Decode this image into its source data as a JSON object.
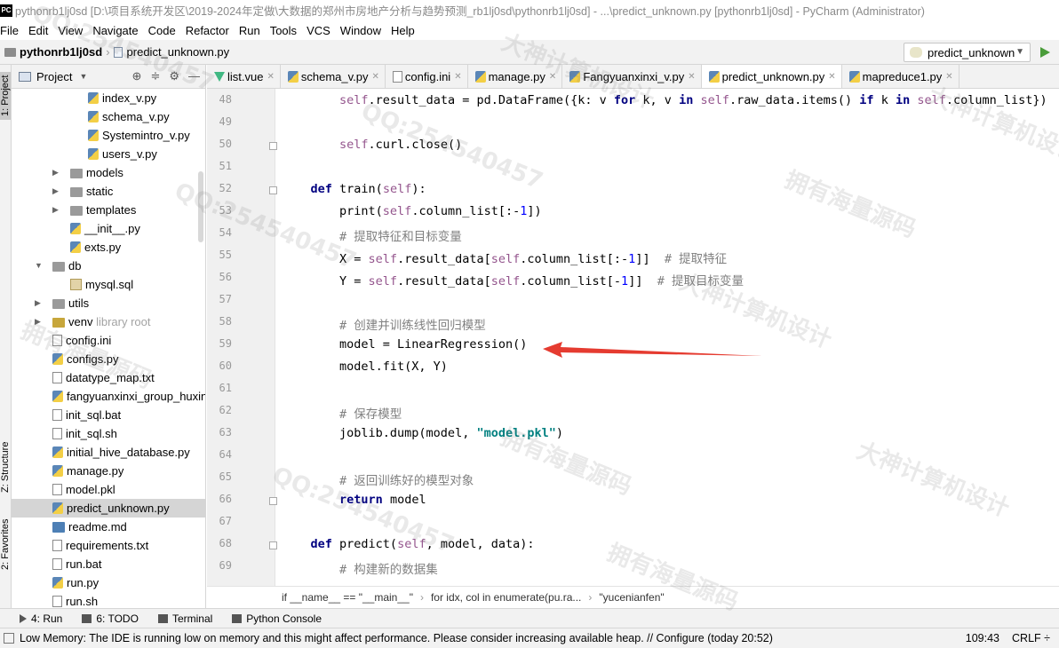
{
  "title_bar": {
    "text": "pythonrb1lj0sd [D:\\项目系统开发区\\2019-2024年定做\\大数据的郑州市房地产分析与趋势预测_rb1lj0sd\\pythonrb1lj0sd] - ...\\predict_unknown.py [pythonrb1lj0sd] - PyCharm (Administrator)"
  },
  "menu": [
    "File",
    "Edit",
    "View",
    "Navigate",
    "Code",
    "Refactor",
    "Run",
    "Tools",
    "VCS",
    "Window",
    "Help"
  ],
  "nav": {
    "project": "pythonrb1lj0sd",
    "file": "predict_unknown.py",
    "run_config": "predict_unknown"
  },
  "left_strip": {
    "project_tab": "1: Project",
    "structure_tab": "Z: Structure",
    "favorites_tab": "2: Favorites"
  },
  "project_panel": {
    "title": "Project",
    "tree": [
      {
        "label": "index_v.py",
        "icon": "python-file-icon",
        "depth": 3
      },
      {
        "label": "schema_v.py",
        "icon": "python-file-icon",
        "depth": 3
      },
      {
        "label": "Systemintro_v.py",
        "icon": "python-file-icon",
        "depth": 3
      },
      {
        "label": "users_v.py",
        "icon": "python-file-icon",
        "depth": 3
      },
      {
        "label": "models",
        "icon": "folder-icon",
        "depth": 2,
        "arrow": "right"
      },
      {
        "label": "static",
        "icon": "folder-icon",
        "depth": 2,
        "arrow": "right"
      },
      {
        "label": "templates",
        "icon": "folder-icon",
        "depth": 2,
        "arrow": "right"
      },
      {
        "label": "__init__.py",
        "icon": "python-file-icon",
        "depth": 2
      },
      {
        "label": "exts.py",
        "icon": "python-file-icon",
        "depth": 2
      },
      {
        "label": "db",
        "icon": "folder-icon",
        "depth": 1,
        "arrow": "down"
      },
      {
        "label": "mysql.sql",
        "icon": "sql-file-icon",
        "depth": 2
      },
      {
        "label": "utils",
        "icon": "folder-icon",
        "depth": 1,
        "arrow": "right"
      },
      {
        "label": "venv",
        "suffix": "library root",
        "icon": "venv-folder-icon",
        "depth": 1,
        "arrow": "right"
      },
      {
        "label": "config.ini",
        "icon": "text-file-icon",
        "depth": 1
      },
      {
        "label": "configs.py",
        "icon": "python-file-icon",
        "depth": 1
      },
      {
        "label": "datatype_map.txt",
        "icon": "text-file-icon",
        "depth": 1
      },
      {
        "label": "fangyuanxinxi_group_huxing",
        "icon": "python-file-icon",
        "depth": 1
      },
      {
        "label": "init_sql.bat",
        "icon": "text-file-icon",
        "depth": 1
      },
      {
        "label": "init_sql.sh",
        "icon": "text-file-icon",
        "depth": 1
      },
      {
        "label": "initial_hive_database.py",
        "icon": "python-file-icon",
        "depth": 1
      },
      {
        "label": "manage.py",
        "icon": "python-file-icon",
        "depth": 1
      },
      {
        "label": "model.pkl",
        "icon": "text-file-icon",
        "depth": 1
      },
      {
        "label": "predict_unknown.py",
        "icon": "python-file-icon",
        "depth": 1,
        "selected": true
      },
      {
        "label": "readme.md",
        "icon": "markdown-file-icon",
        "depth": 1
      },
      {
        "label": "requirements.txt",
        "icon": "text-file-icon",
        "depth": 1
      },
      {
        "label": "run.bat",
        "icon": "text-file-icon",
        "depth": 1
      },
      {
        "label": "run.py",
        "icon": "python-file-icon",
        "depth": 1
      },
      {
        "label": "run.sh",
        "icon": "text-file-icon",
        "depth": 1
      }
    ]
  },
  "tabs": [
    {
      "label": "list.vue",
      "icon": "vue-file-icon"
    },
    {
      "label": "schema_v.py",
      "icon": "python-file-icon"
    },
    {
      "label": "config.ini",
      "icon": "text-file-icon"
    },
    {
      "label": "manage.py",
      "icon": "python-file-icon"
    },
    {
      "label": "Fangyuanxinxi_v.py",
      "icon": "python-file-icon"
    },
    {
      "label": "predict_unknown.py",
      "icon": "python-file-icon",
      "active": true
    },
    {
      "label": "mapreduce1.py",
      "icon": "python-file-icon"
    }
  ],
  "code_lines": [
    {
      "n": "48",
      "html": "        <span class='self'>self</span>.result_data = pd.DataFrame({k: v <span class='kw'>for</span> k, v <span class='kw'>in</span> <span class='self'>self</span>.raw_data.items() <span class='kw'>if</span> k <span class='kw'>in</span> <span class='self'>self</span>.column_list})"
    },
    {
      "n": "49",
      "html": ""
    },
    {
      "n": "50",
      "html": "        <span class='self'>self</span>.curl.close()",
      "fold": true
    },
    {
      "n": "51",
      "html": ""
    },
    {
      "n": "52",
      "html": "    <span class='kw'>def</span> train(<span class='self'>self</span>):",
      "fold": true
    },
    {
      "n": "53",
      "html": "        print(<span class='self'>self</span>.column_list[:-<span class='num'>1</span>])"
    },
    {
      "n": "54",
      "html": "        <span class='cm'># 提取特征和目标变量</span>"
    },
    {
      "n": "55",
      "html": "        X = <span class='self'>self</span>.result_data[<span class='self'>self</span>.column_list[:-<span class='num'>1</span>]]  <span class='cm'># 提取特征</span>"
    },
    {
      "n": "56",
      "html": "        Y = <span class='self'>self</span>.result_data[<span class='self'>self</span>.column_list[-<span class='num'>1</span>]]  <span class='cm'># 提取目标变量</span>"
    },
    {
      "n": "57",
      "html": ""
    },
    {
      "n": "58",
      "html": "        <span class='cm'># 创建并训练线性回归模型</span>"
    },
    {
      "n": "59",
      "html": "        model = LinearRegression()"
    },
    {
      "n": "60",
      "html": "        model.fit(X, Y)"
    },
    {
      "n": "61",
      "html": ""
    },
    {
      "n": "62",
      "html": "        <span class='cm'># 保存模型</span>"
    },
    {
      "n": "63",
      "html": "        joblib.dump(model, <span class='str'>\"model.pkl\"</span>)"
    },
    {
      "n": "64",
      "html": ""
    },
    {
      "n": "65",
      "html": "        <span class='cm'># 返回训练好的模型对象</span>"
    },
    {
      "n": "66",
      "html": "        <span class='kw'>return</span> model",
      "fold": true
    },
    {
      "n": "67",
      "html": ""
    },
    {
      "n": "68",
      "html": "    <span class='kw'>def</span> predict(<span class='self'>self</span>, model, data):",
      "fold": true
    },
    {
      "n": "69",
      "html": "        <span class='cm'># 构建新的数据集</span>"
    }
  ],
  "breadcrumb": [
    "if __name__ == \"__main__\"",
    "for idx, col in enumerate(pu.ra...",
    "\"yucenianfen\""
  ],
  "bottom_tabs": [
    {
      "label": "4: Run",
      "icon": "run-icon"
    },
    {
      "label": "6: TODO",
      "icon": "todo-icon"
    },
    {
      "label": "Terminal",
      "icon": "terminal-icon"
    },
    {
      "label": "Python Console",
      "icon": "python-console-icon"
    }
  ],
  "status": {
    "message": "Low Memory: The IDE is running low on memory and this might affect performance. Please consider increasing available heap. // Configure (today 20:52)",
    "position": "109:43",
    "line_sep": "CRLF ÷"
  },
  "watermarks": [
    "QQ:254540457",
    "大神计算机设计",
    "拥有海量源码",
    "QQ:254540457",
    "大神计算机设计",
    "拥有海量源码",
    "QQ:254540457",
    "大神计算机设计",
    "拥有海量源码",
    "QQ:254540457",
    "大神计算机设计",
    "拥有海量源码"
  ],
  "colors": {
    "arrow": "#e53b30",
    "keyword": "#000080",
    "self": "#94558d",
    "comment": "#808080",
    "string": "#008080"
  }
}
